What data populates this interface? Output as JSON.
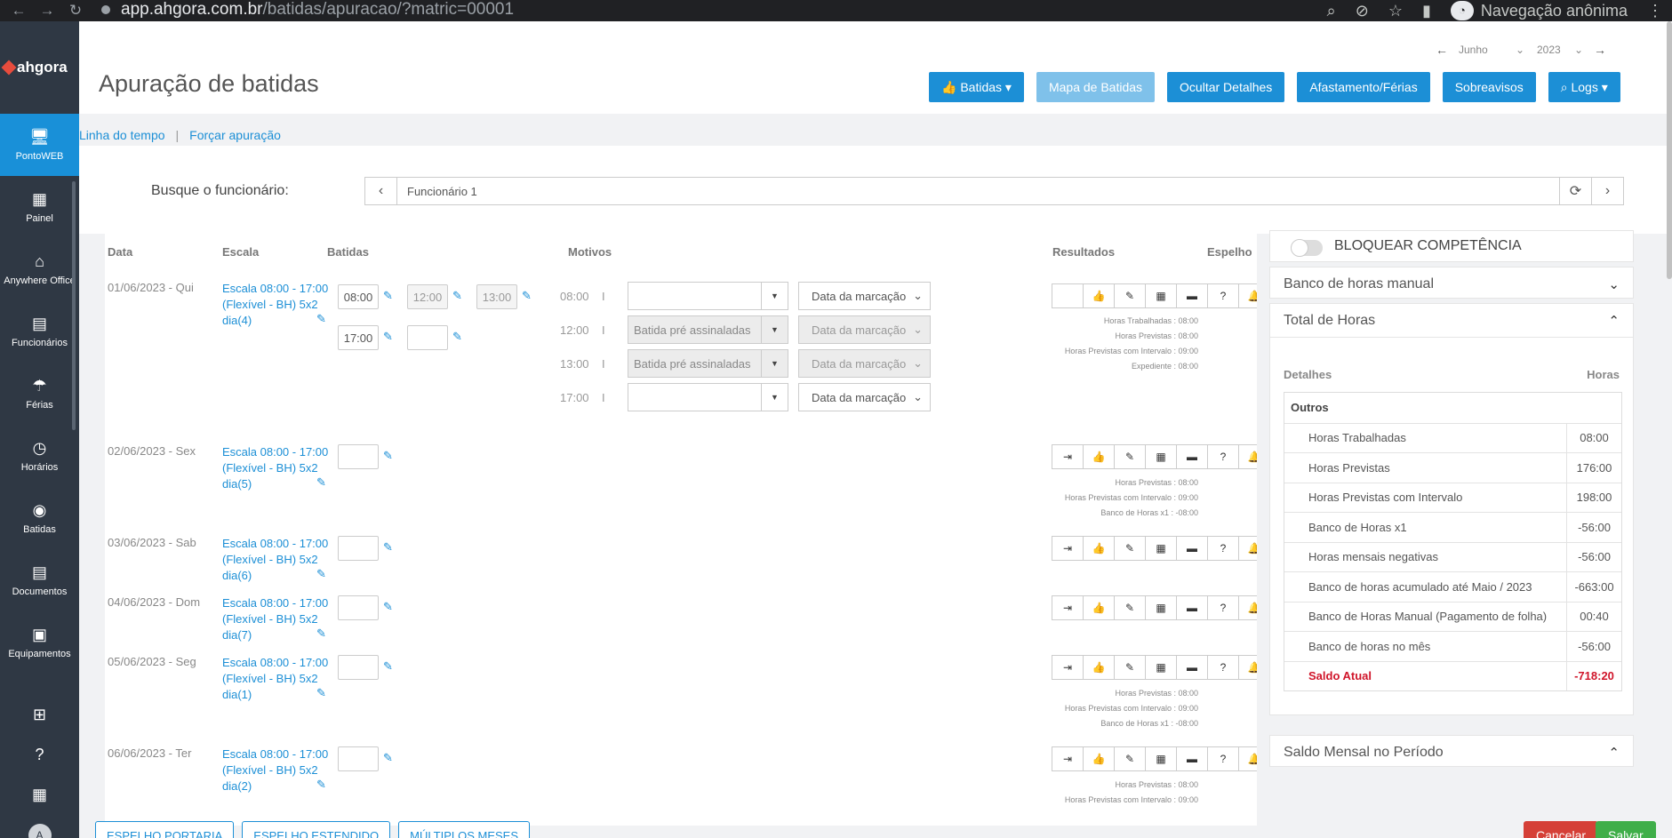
{
  "browser": {
    "url_host": "app.ahgora.com.br",
    "url_path": "/batidas/apuracao/?matric=00001",
    "incognito_label": "Navegação anônima"
  },
  "sidebar": {
    "brand": "ahgora",
    "items": [
      {
        "label": "PontoWEB",
        "icon": "monitor-icon",
        "glyph": "🖥"
      },
      {
        "label": "Painel",
        "icon": "dashboard-icon",
        "glyph": "▦"
      },
      {
        "label": "Anywhere Office",
        "icon": "home-office-icon",
        "glyph": "⌂"
      },
      {
        "label": "Funcionários",
        "icon": "badge-icon",
        "glyph": "▤"
      },
      {
        "label": "Férias",
        "icon": "umbrella-icon",
        "glyph": "☂"
      },
      {
        "label": "Horários",
        "icon": "clock-icon",
        "glyph": "◷"
      },
      {
        "label": "Batidas",
        "icon": "fingerprint-icon",
        "glyph": "◉"
      },
      {
        "label": "Documentos",
        "icon": "document-icon",
        "glyph": "▤"
      },
      {
        "label": "Equipamentos",
        "icon": "device-icon",
        "glyph": "▣"
      }
    ],
    "avatar": "A"
  },
  "header": {
    "title": "Apuração de batidas",
    "month": "Junho",
    "year": "2023",
    "buttons": {
      "batidas": "Batidas",
      "mapa": "Mapa de Batidas",
      "ocultar": "Ocultar Detalhes",
      "afastamento": "Afastamento/Férias",
      "sobreavisos": "Sobreavisos",
      "logs": "Logs"
    }
  },
  "links": {
    "timeline": "Linha do tempo",
    "forcar": "Forçar apuração"
  },
  "employee": {
    "label": "Busque o funcionário:",
    "value": "Funcionário 1"
  },
  "table": {
    "headers": {
      "data": "Data",
      "escala": "Escala",
      "batidas": "Batidas",
      "motivos": "Motivos",
      "resultados": "Resultados",
      "espelho": "Espelho"
    },
    "scale_text": "Escala 08:00 - 17:00 (Flexível - BH) 5x2",
    "days": [
      {
        "date": "01/06/2023 - Qui",
        "dia": "dia(4)",
        "punches": [
          "08:00",
          "12:00",
          "13:00",
          "17:00",
          ""
        ],
        "motivos": [
          {
            "time": "08:00",
            "reason": "",
            "type": "Data da marcação"
          },
          {
            "time": "12:00",
            "reason": "Batida pré assinaladas",
            "type": "Data da marcação"
          },
          {
            "time": "13:00",
            "reason": "Batida pré assinaladas",
            "type": "Data da marcação"
          },
          {
            "time": "17:00",
            "reason": "",
            "type": "Data da marcação"
          }
        ],
        "results": [
          "Horas Trabalhadas : 08:00",
          "Horas Previstas : 08:00",
          "Horas Previstas com Intervalo : 09:00",
          "Expediente : 08:00"
        ]
      },
      {
        "date": "02/06/2023 - Sex",
        "dia": "dia(5)",
        "results": [
          "Horas Previstas : 08:00",
          "Horas Previstas com Intervalo : 09:00",
          "Banco de Horas x1 : -08:00"
        ]
      },
      {
        "date": "03/06/2023 - Sab",
        "dia": "dia(6)"
      },
      {
        "date": "04/06/2023 - Dom",
        "dia": "dia(7)"
      },
      {
        "date": "05/06/2023 - Seg",
        "dia": "dia(1)",
        "results": [
          "Horas Previstas : 08:00",
          "Horas Previstas com Intervalo : 09:00",
          "Banco de Horas x1 : -08:00"
        ]
      },
      {
        "date": "06/06/2023 - Ter",
        "dia": "dia(2)",
        "results": [
          "Horas Previstas : 08:00",
          "Horas Previstas com Intervalo : 09:00"
        ]
      }
    ]
  },
  "right": {
    "bloquear": "BLOQUEAR COMPETÊNCIA",
    "banco_manual": "Banco de horas manual",
    "total_horas": "Total de Horas",
    "detalhes": "Detalhes",
    "horas": "Horas",
    "outros": "Outros",
    "rows": [
      {
        "label": "Horas Trabalhadas",
        "value": "08:00"
      },
      {
        "label": "Horas Previstas",
        "value": "176:00"
      },
      {
        "label": "Horas Previstas com Intervalo",
        "value": "198:00"
      },
      {
        "label": "Banco de Horas x1",
        "value": "-56:00"
      },
      {
        "label": "Horas mensais negativas",
        "value": "-56:00"
      },
      {
        "label": "Banco de horas acumulado até Maio / 2023",
        "value": "-663:00"
      },
      {
        "label": "Banco de Horas Manual (Pagamento de folha)",
        "value": "00:40"
      },
      {
        "label": "Banco de horas no mês",
        "value": "-56:00"
      }
    ],
    "saldo_label": "Saldo Atual",
    "saldo_value": "-718:20",
    "saldo_mensal": "Saldo Mensal no Período"
  },
  "footer": {
    "espelho_portaria": "ESPELHO PORTARIA",
    "espelho_estendido": "ESPELHO ESTENDIDO",
    "multiplos": "MÚLTIPLOS MESES",
    "cancelar": "Cancelar",
    "salvar": "Salvar"
  },
  "colors": {
    "primary": "#1c8fd6",
    "sidebar": "#2f3844",
    "danger": "#d54037",
    "success": "#3fae49"
  }
}
